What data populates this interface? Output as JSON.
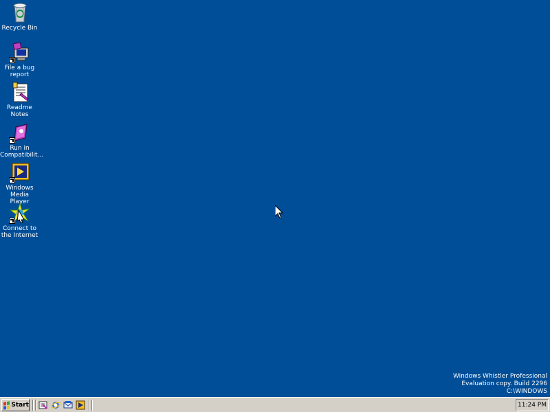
{
  "desktop": {
    "background_color": "#004e98",
    "icons": [
      {
        "label": "Recycle Bin",
        "icon": "recycle-bin-icon"
      },
      {
        "label": "File a bug\nreport",
        "icon": "bug-report-icon"
      },
      {
        "label": "Readme Notes",
        "icon": "readme-notes-icon"
      },
      {
        "label": "Run in\nCompatibilit...",
        "icon": "compatibility-icon"
      },
      {
        "label": "Windows\nMedia Player",
        "icon": "media-player-icon"
      },
      {
        "label": "Connect to\nthe Internet",
        "icon": "connect-internet-icon"
      }
    ]
  },
  "watermark": {
    "line1": "Windows Whistler Professional",
    "line2": "Evaluation copy. Build 2296",
    "line3": "C:\\WINDOWS"
  },
  "taskbar": {
    "start_label": "Start",
    "quick_launch": [
      "show-desktop-icon",
      "internet-explorer-icon",
      "outlook-express-icon",
      "media-player-icon"
    ],
    "clock": "11:24 PM"
  }
}
